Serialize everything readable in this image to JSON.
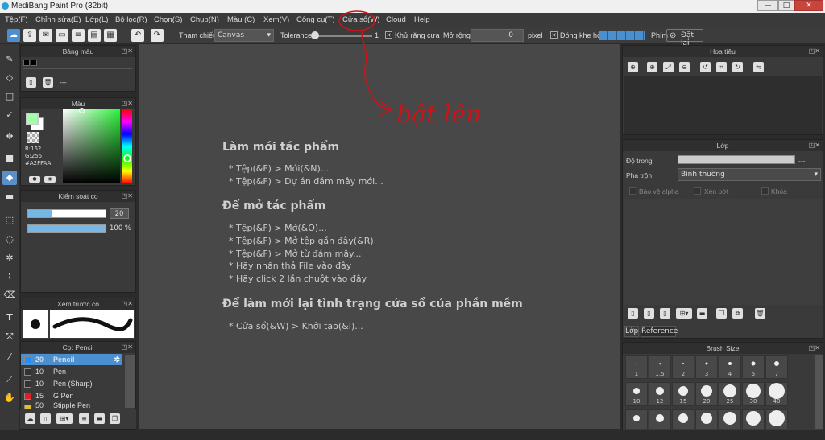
{
  "window": {
    "title": "MediBang Paint Pro (32bit)",
    "minimize": "—",
    "maximize": "□",
    "close": "✕"
  },
  "menu": [
    "Tệp(F)",
    "Chỉnh sửa(E)",
    "Lớp(L)",
    "Bộ lọc(R)",
    "Chọn(S)",
    "Chụp(N)",
    "Màu (C)",
    "Xem(V)",
    "Công cụ(T)",
    "Cửa sổ(W)",
    "Cloud",
    "Help"
  ],
  "toolbar": {
    "ref_label": "Tham chiếu",
    "ref_value": "Canvas",
    "tolerance_label": "Tolerance",
    "tolerance_value": "1",
    "antialias_label": "Khử răng cưa",
    "expand_label": "Mở rộng",
    "expand_value": "0",
    "pixel_label": "pixel",
    "close_gap_label": "Đóng khe hở",
    "phim_label": "Phím",
    "reset_label": "Đặt lại"
  },
  "palette_panel": {
    "title": "Bảng màu",
    "dash": "---"
  },
  "color_panel": {
    "title": "Màu",
    "r": "R:162",
    "g": "G:255",
    "hex": "#A2FFAA",
    "primary_color": "#a2ffaa",
    "secondary_color": "#ffffff"
  },
  "brush_control": {
    "title": "Kiểm soát cọ",
    "size": "20",
    "opacity": "100 %",
    "size_fraction": 0.3,
    "opacity_fraction": 1.0
  },
  "brush_preview": {
    "title": "Xem trước cọ"
  },
  "brush_list": {
    "title": "Cọ: Pencil",
    "items": [
      {
        "size": "20",
        "name": "Pencil",
        "color": "#1e90ff",
        "selected": true
      },
      {
        "size": "10",
        "name": "Pen",
        "color": "#333333"
      },
      {
        "size": "10",
        "name": "Pen (Sharp)",
        "color": "#333333"
      },
      {
        "size": "15",
        "name": "G Pen",
        "color": "#e02020"
      },
      {
        "size": "50",
        "name": "Stipple Pen",
        "color": "#e0c020"
      }
    ]
  },
  "canvas": {
    "section1_title": "Làm mới tác phẩm",
    "section1_items": [
      "* Tệp(&F) > Mới(&N)...",
      "* Tệp(&F) > Dự án đám mây mới..."
    ],
    "section2_title": "Để mở tác phẩm",
    "section2_items": [
      "* Tệp(&F) > Mở(&O)...",
      "* Tệp(&F) > Mở tệp gần đây(&R)",
      "* Tệp(&F) > Mở từ đám mây...",
      "* Hãy nhấn thả File vào đây",
      "* Hãy click 2 lần chuột vào đây"
    ],
    "section3_title": "Để làm mới lại tình trạng cửa sổ của phần mềm",
    "section3_items": [
      "* Cửa sổ(&W) > Khởi tạo(&I)..."
    ]
  },
  "annotation": {
    "text": "bật lên",
    "color": "#c8151b"
  },
  "navigator_panel": {
    "title": "Hoa tiêu"
  },
  "layer_panel": {
    "title": "Lớp",
    "opacity_label": "Độ trong",
    "opacity_value": "---",
    "blend_label": "Pha trộn",
    "blend_value": "Bình thường",
    "protect_alpha": "Bảo vệ alpha",
    "clipping": "Xén bớt",
    "lock": "Khóa",
    "tab_layer": "Lớp",
    "tab_reference": "Reference"
  },
  "brush_size_panel": {
    "title": "Brush Size",
    "row1": [
      "1",
      "1.5",
      "2",
      "3",
      "4",
      "5",
      "7"
    ],
    "row2": [
      "10",
      "12",
      "15",
      "20",
      "25",
      "30",
      "40"
    ]
  }
}
